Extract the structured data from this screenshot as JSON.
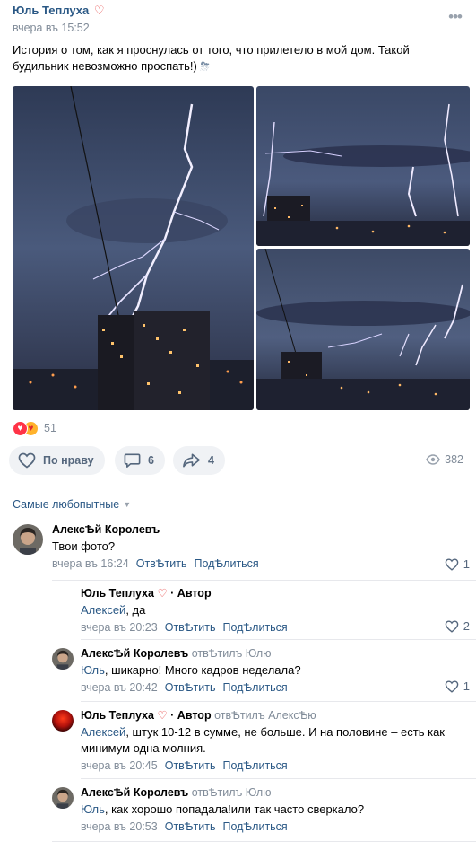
{
  "post": {
    "author": "Юль Теплуха",
    "author_emoji": "♡",
    "time": "вчера въ 15:52",
    "text": "История о том, как я проснулась от того, что прилетело в мой дом. Такой будильник невозможно проспать!)",
    "text_emoji": "⛈",
    "more": "•••",
    "reaction_count": "51",
    "like_label": "По нраву",
    "comment_count": "6",
    "share_count": "4",
    "views": "382",
    "accent": "#2a5885"
  },
  "comments_header": {
    "sort_label": "Самые любопытные"
  },
  "comments": [
    {
      "name": "АлексѢй Королевъ",
      "text": "Твои фото?",
      "time": "вчера въ 16:24",
      "reply": "ОтвѢтить",
      "share": "ПодѢлиться",
      "likes": "1"
    },
    {
      "name": "Юль Теплуха",
      "emoji": "♡",
      "role": "· Автор",
      "mention": "Алексей",
      "text": ", да",
      "time": "вчера въ 20:23",
      "reply": "ОтвѢтить",
      "share": "ПодѢлиться",
      "likes": "2"
    },
    {
      "name": "АлексѢй Королевъ",
      "replied": "отвѢтилъ Юлю",
      "mention": "Юль",
      "text": ", шикарно! Много кадров неделала?",
      "time": "вчера въ 20:42",
      "reply": "ОтвѢтить",
      "share": "ПодѢлиться",
      "likes": "1"
    },
    {
      "name": "Юль Теплуха",
      "emoji": "♡",
      "role": "· Автор",
      "replied": "отвѢтилъ АлексѢю",
      "mention": "Алексей",
      "text": ", штук 10-12 в сумме, не больше. И на половине – есть как минимум одна молния.",
      "time": "вчера въ 20:45",
      "reply": "ОтвѢтить",
      "share": "ПодѢлиться"
    },
    {
      "name": "АлексѢй Королевъ",
      "replied": "отвѢтилъ Юлю",
      "mention": "Юль",
      "text": ", как хорошо попадала!или так часто сверкало?",
      "time": "вчера въ 20:53",
      "reply": "ОтвѢтить",
      "share": "ПодѢлиться"
    }
  ]
}
